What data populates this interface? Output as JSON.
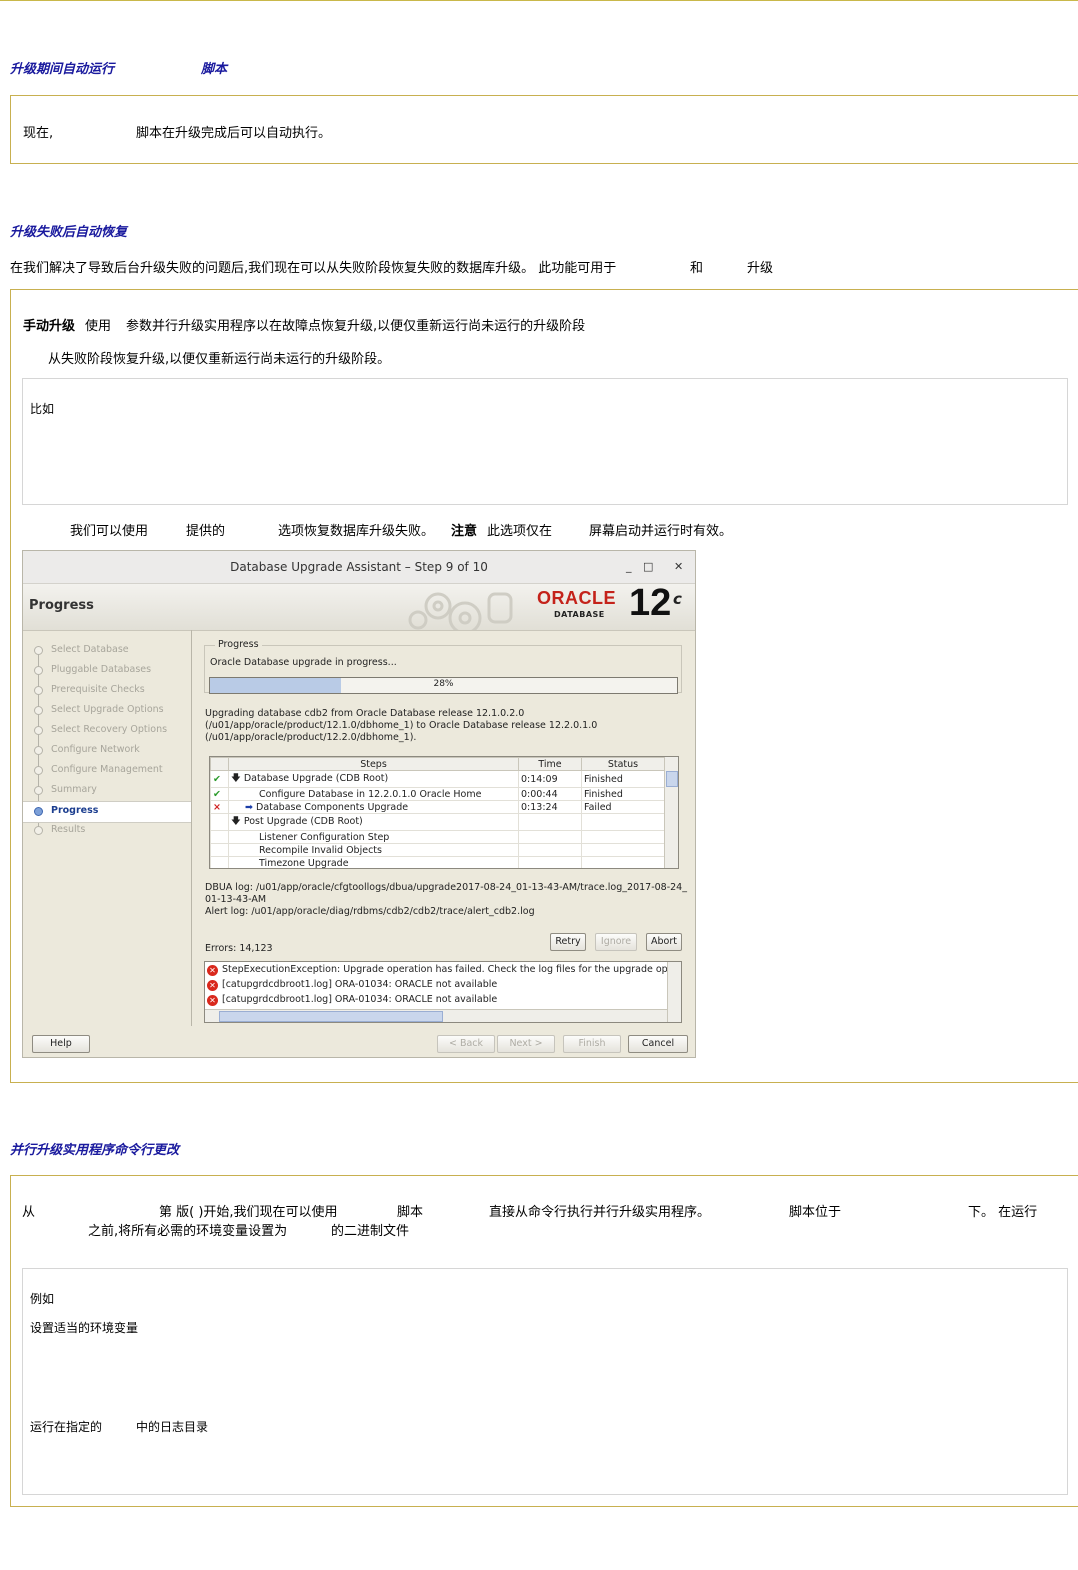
{
  "s1": {
    "heading": "升级期间自动运行",
    "heading_tail": "脚本",
    "box_lead": "现在,",
    "box_text": "脚本在升级完成后可以自动执行。"
  },
  "s2": {
    "heading": "升级失败后自动恢复",
    "intro": "在我们解决了导致后台升级失败的问题后,我们现在可以从失败阶段恢复失败的数据库升级。 此功能可用于",
    "intro_and": "和",
    "intro_end": "升级",
    "manual_label": "手动升级",
    "manual_use": "使用",
    "manual_text": "参数并行升级实用程序以在故障点恢复升级,以便仅重新运行尚未运行的升级阶段",
    "resume_text": "从失败阶段恢复升级,以便仅重新运行尚未运行的升级阶段。",
    "example_label": "比如",
    "dbua_a": "我们可以使用",
    "dbua_b": "提供的",
    "dbua_c": "选项恢复数据库升级失败。",
    "note_label": "注意",
    "dbua_d": "此选项仅在",
    "dbua_e": "屏幕启动并运行时有效。"
  },
  "dialog": {
    "title": "Database Upgrade Assistant – Step 9 of 10",
    "banner_title": "Progress",
    "logo_text": "ORACLE",
    "logo_sub": "DATABASE",
    "logo_version": "12",
    "logo_suffix": "c",
    "nav": [
      "Select Database",
      "Pluggable Databases",
      "Prerequisite Checks",
      "Select Upgrade Options",
      "Select Recovery Options",
      "Configure Network",
      "Configure Management",
      "Summary",
      "Progress",
      "Results"
    ],
    "progress_legend": "Progress",
    "progress_status": "Oracle Database upgrade in progress...",
    "progress_percent": 28,
    "progress_label": "28%",
    "desc1": "Upgrading database cdb2 from Oracle Database release 12.1.0.2.0",
    "desc2": "(/u01/app/oracle/product/12.1.0/dbhome_1) to Oracle Database release 12.2.0.1.0",
    "desc3": "(/u01/app/oracle/product/12.2.0/dbhome_1).",
    "steps_headers": [
      "Steps",
      "Time",
      "Status"
    ],
    "steps": [
      {
        "name": "Database Upgrade (CDB Root)",
        "time": "0:14:09",
        "status": "Finished"
      },
      {
        "name": "Configure Database in 12.2.0.1.0 Oracle Home",
        "time": "0:00:44",
        "status": "Finished"
      },
      {
        "name": "Database Components Upgrade",
        "time": "0:13:24",
        "status": "Failed"
      },
      {
        "name": "Post Upgrade (CDB Root)",
        "time": "",
        "status": ""
      },
      {
        "name": "Listener Configuration Step",
        "time": "",
        "status": ""
      },
      {
        "name": "Recompile Invalid Objects",
        "time": "",
        "status": ""
      },
      {
        "name": "Timezone Upgrade",
        "time": "",
        "status": ""
      }
    ],
    "dbua_log1": "DBUA log: /u01/app/oracle/cfgtoollogs/dbua/upgrade2017-08-24_01-13-43-AM/trace.log_2017-08-24_",
    "dbua_log2": "01-13-43-AM",
    "alert_log": "Alert log: /u01/app/oracle/diag/rdbms/cdb2/cdb2/trace/alert_cdb2.log",
    "errors": "Errors: 14,123",
    "retry": "Retry",
    "ignore": "Ignore",
    "abort": "Abort",
    "error_lines": [
      "StepExecutionException: Upgrade operation has failed. Check the log files for the upgrade op",
      "[catupgrdcdbroot1.log] ORA-01034: ORACLE not available",
      "[catupgrdcdbroot1.log] ORA-01034: ORACLE not available"
    ],
    "help": "Help",
    "back": "< Back",
    "next": "Next >",
    "finish": "Finish",
    "cancel": "Cancel"
  },
  "s3": {
    "heading": "并行升级实用程序命令行更改",
    "p_from": "从",
    "p_version": "第 版(   )开始,我们现在可以使用",
    "p_script": "脚本",
    "p_direct": "直接从命令行执行并行升级实用程序。",
    "p_script2": "脚本位于",
    "p_under": "下。 在运行",
    "p_line2": "之前,将所有必需的环境变量设置为",
    "p_bin": "的二进制文件",
    "example_label": "例如",
    "env_label": "设置适当的环境变量",
    "run_label": "运行在指定的",
    "log_label": "中的日志目录"
  }
}
